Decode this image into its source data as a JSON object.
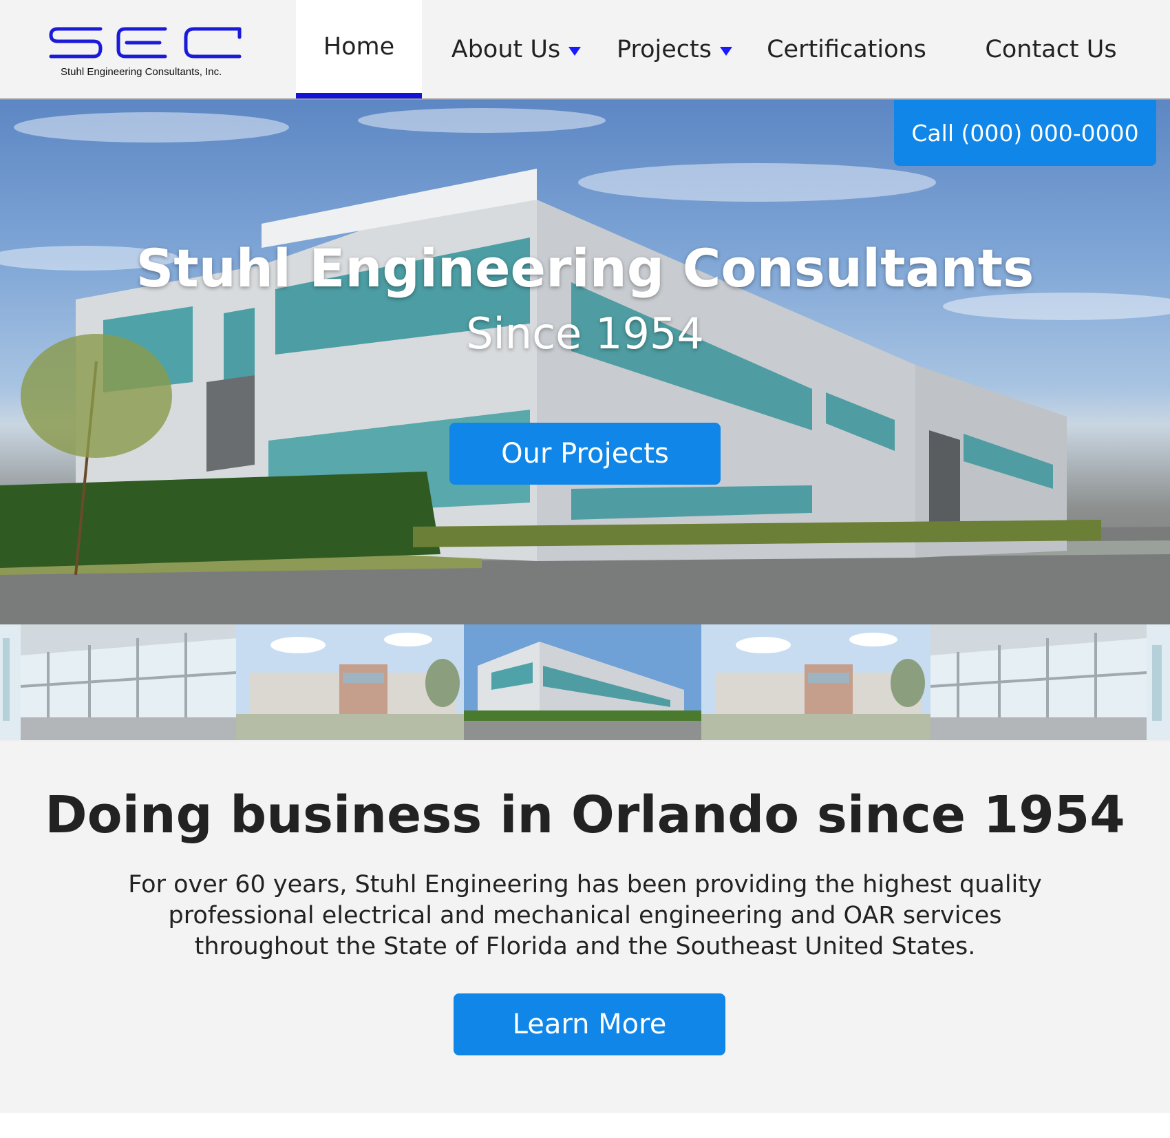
{
  "brand": {
    "logo_letters": "SEC",
    "company_name": "Stuhl Engineering Consultants, Inc.",
    "logo_color": "#1a1ad9"
  },
  "nav": {
    "items": [
      {
        "label": "Home",
        "active": true,
        "has_dropdown": false
      },
      {
        "label": "About Us",
        "active": false,
        "has_dropdown": true
      },
      {
        "label": "Projects",
        "active": false,
        "has_dropdown": true
      },
      {
        "label": "Certifications",
        "active": false,
        "has_dropdown": false
      },
      {
        "label": "Contact Us",
        "active": false,
        "has_dropdown": false
      }
    ],
    "active_indicator_color": "#1313d6",
    "caret_icon": "caret-down-icon"
  },
  "hero": {
    "call_button": "Call (000) 000-0000",
    "title": "Stuhl Engineering Consultants",
    "subtitle": "Since 1954",
    "cta_button": "Our Projects",
    "button_color": "#0f86e8"
  },
  "thumbnails": [
    {
      "name": "thumb-lobby-window"
    },
    {
      "name": "thumb-round-building"
    },
    {
      "name": "thumb-office-building"
    },
    {
      "name": "thumb-round-building"
    },
    {
      "name": "thumb-lobby-window"
    }
  ],
  "about": {
    "title": "Doing business in Orlando since 1954",
    "text": "For over 60 years, Stuhl Engineering has been providing the highest quality professional electrical and mechanical engineering and OAR services throughout the State of Florida and the Southeast United States.",
    "cta_button": "Learn More"
  }
}
